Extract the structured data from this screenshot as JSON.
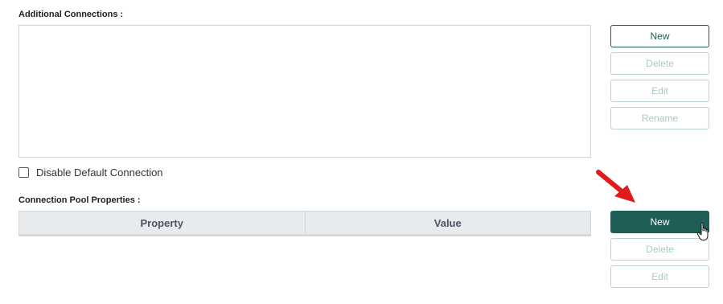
{
  "additional_connections": {
    "label": "Additional Connections :",
    "buttons": {
      "new": "New",
      "delete": "Delete",
      "edit": "Edit",
      "rename": "Rename"
    }
  },
  "disable_default_connection": {
    "label": "Disable Default Connection",
    "checked": false
  },
  "connection_pool": {
    "label": "Connection Pool Properties :",
    "columns": [
      "Property",
      "Value"
    ],
    "buttons": {
      "new": "New",
      "delete": "Delete",
      "edit": "Edit"
    }
  },
  "icons": {
    "annotation": "red-arrow-icon",
    "pointer": "hand-pointer-icon"
  },
  "colors": {
    "primary": "#1d5e56",
    "disabled_border": "#b9d6d2",
    "disabled_text": "#a9c9c5",
    "annotation_arrow": "#e01b1b"
  }
}
